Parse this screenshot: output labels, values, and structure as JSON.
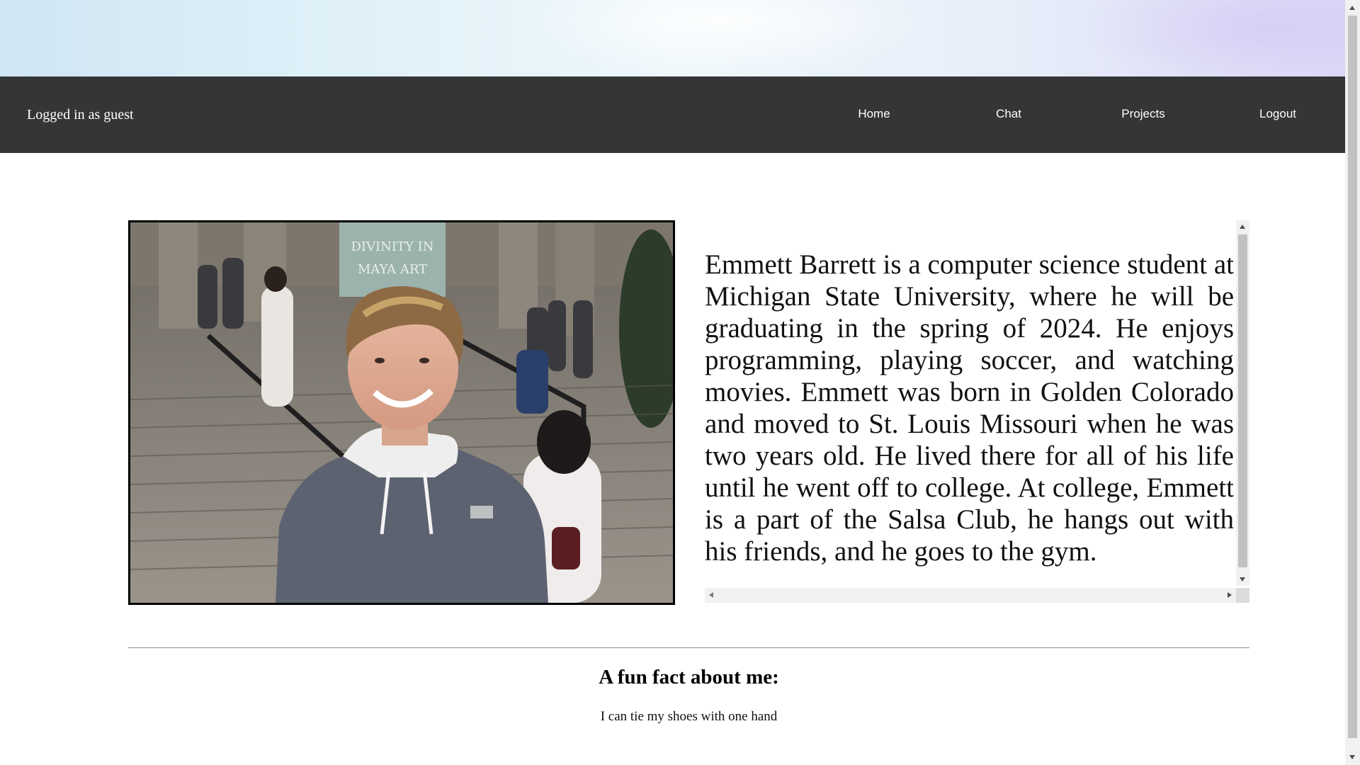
{
  "navbar": {
    "status": "Logged in as guest",
    "links": [
      {
        "label": "Home"
      },
      {
        "label": "Chat"
      },
      {
        "label": "Projects"
      },
      {
        "label": "Logout"
      }
    ]
  },
  "about": {
    "bio": "Emmett Barrett is a computer science student at Michigan State University, where he will be graduating in the spring of 2024. He enjoys programming, playing soccer, and watching movies. Emmett was born in Golden Colorado and moved to St. Louis Missouri when he was two years old. He lived there for all of his life until he went off to college. At college, Emmett is a part of the Salsa Club, he hangs out with his friends, and he goes to the gym.",
    "photo_sign_text": "THE GODS DIVINITY IN MAYA ART"
  },
  "fun_fact": {
    "heading": "A fun fact about me:",
    "text": "I can tie my shoes with one hand"
  },
  "colors": {
    "navbar_bg": "#343537",
    "nav_text": "#ffffff",
    "page_bg": "#ffffff"
  }
}
